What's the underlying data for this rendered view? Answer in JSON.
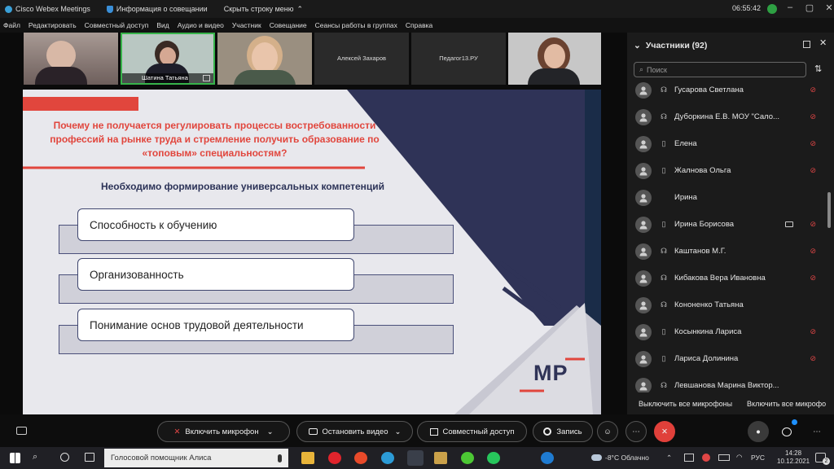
{
  "titlebar": {
    "app_title": "Cisco Webex Meetings",
    "meeting_info": "Информация о совещании",
    "hide_menu": "Скрыть строку меню",
    "timer": "06:55:42"
  },
  "menu": [
    "Файл",
    "Редактировать",
    "Совместный доступ",
    "Вид",
    "Аудио и видео",
    "Участник",
    "Совещание",
    "Сеансы работы в группах",
    "Справка"
  ],
  "video_tiles": [
    {
      "name": ""
    },
    {
      "name": "Шатина Татьяна"
    },
    {
      "name": ""
    },
    {
      "name": "Алексей Захаров"
    },
    {
      "name": "Педагог13.РУ"
    },
    {
      "name": ""
    }
  ],
  "slide": {
    "question": "Почему не получается регулировать процессы востребованности профессий на рынке труда и стремление получить образование по «топовым» специальностям?",
    "subtitle": "Необходимо формирование универсальных компетенций",
    "items": [
      "Способность к обучению",
      "Организованность",
      "Понимание основ трудовой деятельности"
    ],
    "logo": "МР",
    "colors": {
      "accent": "#e1463d",
      "navy": "#2c3358",
      "band": "#d0d0d9"
    }
  },
  "participants": {
    "title": "Участники (92)",
    "search_placeholder": "Поиск",
    "list": [
      {
        "name": "Гусарова Светлана",
        "device": "headset-icon",
        "muted": true
      },
      {
        "name": "Дуборкина Е.В. МОУ \"Сало...",
        "device": "headset-icon",
        "muted": true
      },
      {
        "name": "Елена",
        "device": "phone-icon",
        "muted": true
      },
      {
        "name": "Жалнова Ольга",
        "device": "phone-icon",
        "muted": true
      },
      {
        "name": "Ирина",
        "device": "",
        "muted": false
      },
      {
        "name": "Ирина Борисова",
        "device": "phone-icon",
        "muted": true,
        "video": true
      },
      {
        "name": "Каштанов М.Г.",
        "device": "headset-icon",
        "muted": true
      },
      {
        "name": "Кибакова Вера Ивановна",
        "device": "headset-icon",
        "muted": true
      },
      {
        "name": "Кононенко Татьяна",
        "device": "headset-icon",
        "muted": false
      },
      {
        "name": "Косынкина Лариса",
        "device": "phone-icon",
        "muted": true
      },
      {
        "name": "Лариса Долинина",
        "device": "phone-icon",
        "muted": true
      },
      {
        "name": "Левшанова Марина Виктор...",
        "device": "headset-icon",
        "muted": false
      }
    ],
    "mute_all": "Выключить все микрофоны",
    "unmute_all": "Включить все микрофо"
  },
  "controls": {
    "mic": "Включить микрофон",
    "video": "Остановить видео",
    "share": "Совместный доступ",
    "record": "Запись",
    "chat_badge": "•"
  },
  "taskbar": {
    "search_text": "Голосовой помощник Алиса",
    "weather": "-8°С Облачно",
    "lang": "РУС",
    "time": "14:28",
    "date": "10.12.2021",
    "notif_count": "2"
  }
}
